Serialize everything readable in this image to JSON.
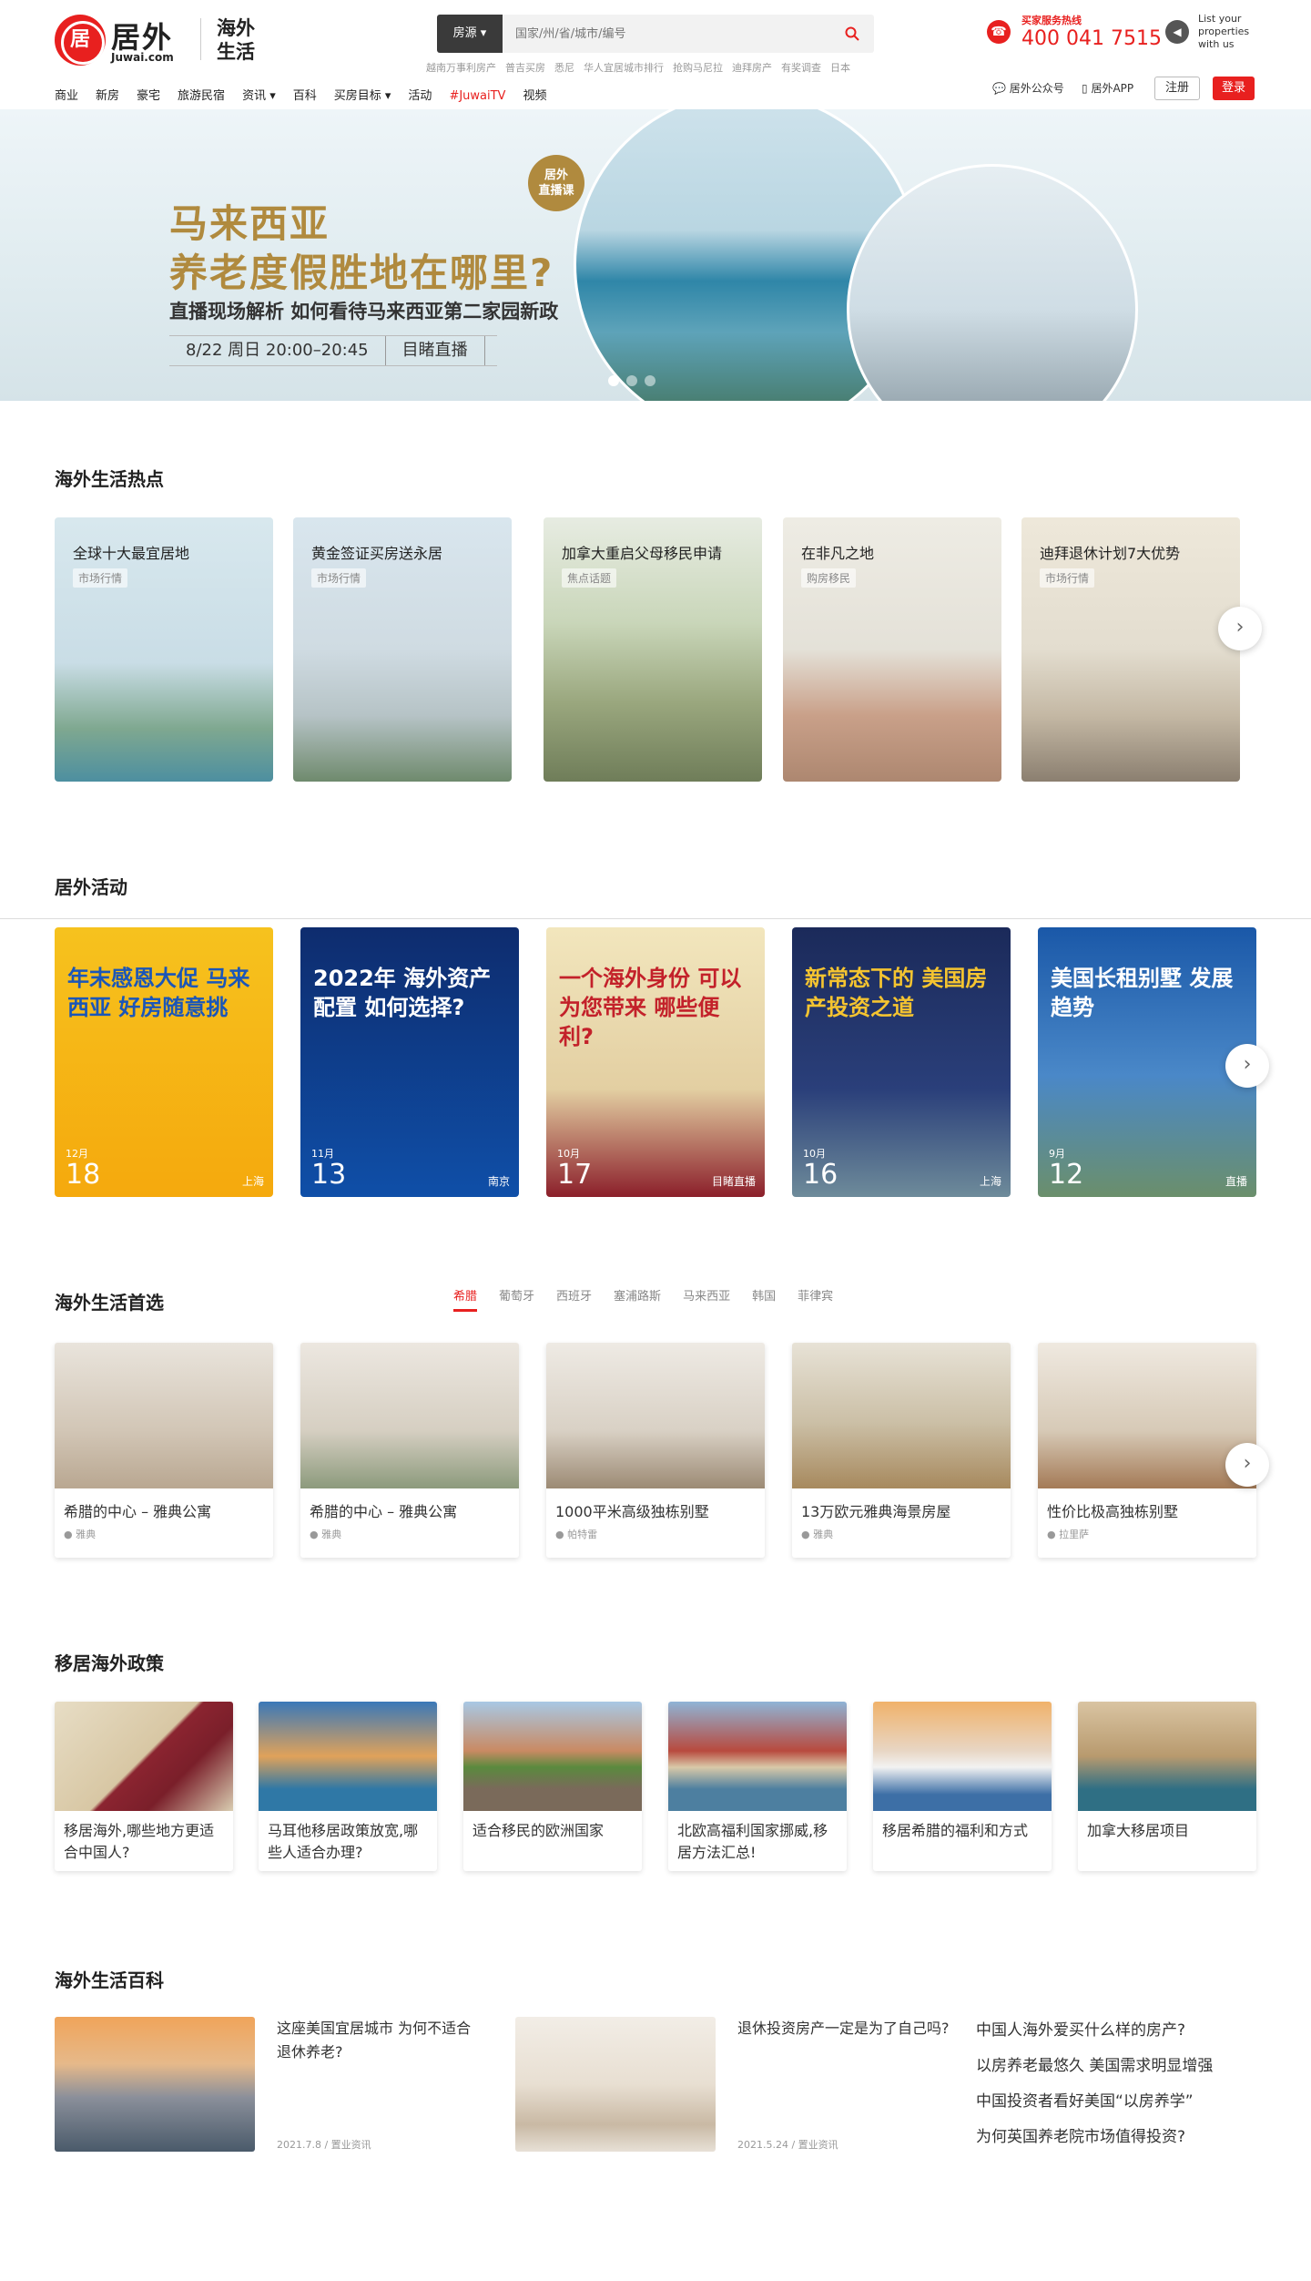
{
  "header": {
    "logo_char": "居",
    "brand_cn": "居外",
    "brand_en": "Juwai.com",
    "life_line1": "海外",
    "life_line2": "生活",
    "search_type": "房源 ▾",
    "search_placeholder": "国家/州/省/城市/编号",
    "search_icon": "search-icon",
    "hot_links": [
      "越南万事利房产",
      "普吉买房",
      "悉尼",
      "华人宜居城市排行",
      "抢购马尼拉",
      "迪拜房产",
      "有奖调查",
      "日本"
    ],
    "hotline_label": "买家服务热线",
    "hotline_number": "400 041 7515",
    "list_property": [
      "List your",
      "properties",
      "with us"
    ],
    "nav": [
      "商业",
      "新房",
      "豪宅",
      "旅游民宿",
      "资讯 ▾",
      "百科",
      "买房目标 ▾",
      "活动",
      "#JuwaiTV",
      "视频"
    ],
    "wechat": "居外公众号",
    "app": "居外APP",
    "register": "注册",
    "login": "登录"
  },
  "banner": {
    "title1": "马来西亚",
    "title2": "养老度假胜地在哪里?",
    "subtitle": "直播现场解析 如何看待马来西亚第二家园新政",
    "date": "8/22 周日 20:00–20:45",
    "mode": "目睹直播",
    "badge_line1": "居外",
    "badge_line2": "直播课"
  },
  "hot": {
    "title": "海外生活热点",
    "items": [
      {
        "title": "全球十大最宜居地",
        "tag": "市场行情"
      },
      {
        "title": "黄金签证买房送永居",
        "tag": "市场行情"
      },
      {
        "title": "加拿大重启父母移民申请",
        "tag": "焦点话题"
      },
      {
        "title": "在非凡之地",
        "tag": "购房移民"
      },
      {
        "title": "迪拜退休计划7大优势",
        "tag": "市场行情"
      }
    ]
  },
  "events": {
    "title": "居外活动",
    "items": [
      {
        "text": "年末感恩大促 马来西亚 好房随意挑",
        "month": "12月",
        "day": "18",
        "loc": "上海"
      },
      {
        "text": "2022年 海外资产配置 如何选择?",
        "month": "11月",
        "day": "13",
        "loc": "南京"
      },
      {
        "text": "一个海外身份 可以为您带来 哪些便利?",
        "month": "10月",
        "day": "17",
        "loc": "目睹直播"
      },
      {
        "text": "新常态下的 美国房产投资之道",
        "month": "10月",
        "day": "16",
        "loc": "上海"
      },
      {
        "text": "美国长租别墅 发展趋势",
        "month": "9月",
        "day": "12",
        "loc": "直播"
      }
    ]
  },
  "picks": {
    "title": "海外生活首选",
    "tabs": [
      "希腊",
      "葡萄牙",
      "西班牙",
      "塞浦路斯",
      "马来西亚",
      "韩国",
      "菲律宾"
    ],
    "items": [
      {
        "title": "希腊的中心 – 雅典公寓",
        "loc": "雅典"
      },
      {
        "title": "希腊的中心 – 雅典公寓",
        "loc": "雅典"
      },
      {
        "title": "1000平米高级独栋别墅",
        "loc": "帕特雷"
      },
      {
        "title": "13万欧元雅典海景房屋",
        "loc": "雅典"
      },
      {
        "title": "性价比极高独栋别墅",
        "loc": "拉里萨"
      }
    ]
  },
  "policy": {
    "title": "移居海外政策",
    "items": [
      {
        "title": "移居海外,哪些地方更适合中国人?"
      },
      {
        "title": "马耳他移居政策放宽,哪些人适合办理?"
      },
      {
        "title": "适合移民的欧洲国家"
      },
      {
        "title": "北欧高福利国家挪威,移居方法汇总!"
      },
      {
        "title": "移居希腊的福利和方式"
      },
      {
        "title": "加拿大移居项目"
      }
    ]
  },
  "wiki": {
    "title": "海外生活百科",
    "a1": {
      "title": "这座美国宜居城市 为何不适合退休养老?",
      "date": "2021.7.8 / 置业资讯"
    },
    "a2": {
      "title": "退休投资房产一定是为了自己吗?",
      "date": "2021.5.24 / 置业资讯"
    },
    "list": [
      "中国人海外爱买什么样的房产?",
      "以房养老最悠久 美国需求明显增强",
      "中国投资者看好美国“以房养学”",
      "为何英国养老院市场值得投资?"
    ]
  }
}
